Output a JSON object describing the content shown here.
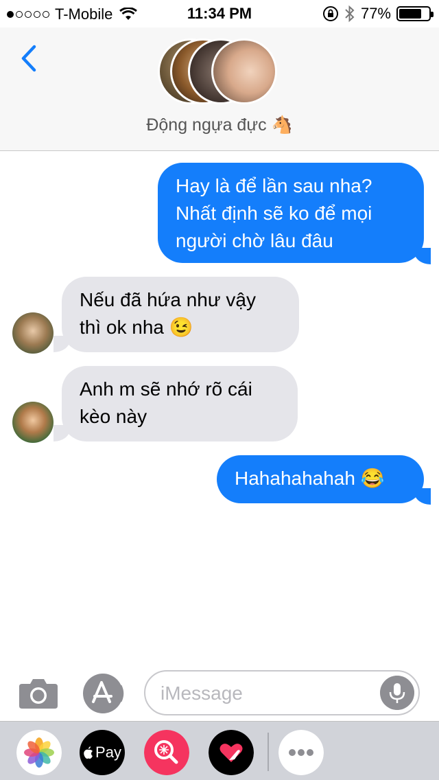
{
  "status_bar": {
    "carrier": "T-Mobile",
    "time": "11:34 PM",
    "battery_percent": "77%",
    "battery_level": 0.77,
    "signal_bars_filled": 1,
    "signal_bars_total": 5
  },
  "header": {
    "contact_name": "Động ngựa đực 🐴"
  },
  "messages": [
    {
      "direction": "outgoing",
      "lines": [
        "Hay là để lần sau nha?",
        "Nhất định sẽ ko để mọi",
        "người chờ lâu đâu"
      ]
    },
    {
      "direction": "incoming",
      "lines": [
        "Nếu đã hứa như vậy",
        "thì ok nha 😉"
      ]
    },
    {
      "direction": "incoming",
      "lines": [
        "Anh m sẽ nhớ rõ cái",
        "kèo này"
      ]
    },
    {
      "direction": "outgoing",
      "lines": [
        "Hahahahahah 😂"
      ]
    }
  ],
  "input": {
    "placeholder": "iMessage"
  },
  "app_drawer": {
    "apple_pay_label": "Pay",
    "items": [
      "photos-app-icon",
      "apple-pay-icon",
      "search-images-icon",
      "digital-touch-icon",
      "more-apps-icon"
    ]
  },
  "colors": {
    "outgoing_bubble": "#147efb",
    "incoming_bubble": "#e5e5ea",
    "accent": "#147efb"
  }
}
